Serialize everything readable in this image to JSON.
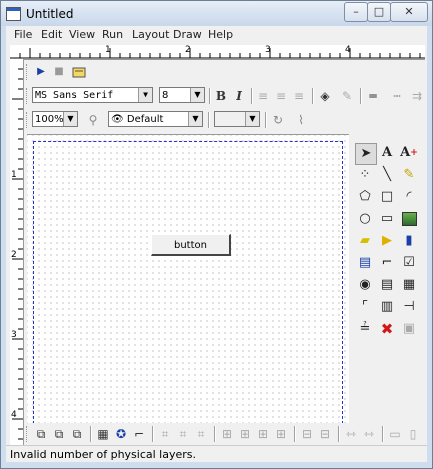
{
  "window": {
    "title": "Untitled"
  },
  "titlebar_buttons": {
    "minimize": "–",
    "maximize": "□",
    "close": "✕"
  },
  "menu": [
    "File",
    "Edit",
    "View",
    "Run",
    "Layout",
    "Draw",
    "Help"
  ],
  "ruler": {
    "horizontal_labels": [
      "1",
      "2",
      "3",
      "4"
    ],
    "vertical_labels": [
      "1",
      "2",
      "3",
      "4"
    ]
  },
  "run_toolbar": {
    "run_icon": "▶",
    "stop_icon": "■",
    "edit_icon": "edit-icon"
  },
  "format_toolbar": {
    "font_name": "MS Sans Serif",
    "font_size": "8",
    "bold": "B",
    "italic": "I"
  },
  "view_toolbar": {
    "zoom": "100%",
    "visual_state": "Default",
    "layer_value": ""
  },
  "canvas": {
    "button_label": "button"
  },
  "status": {
    "message": "Invalid number of physical layers."
  },
  "palette": [
    "pointer-icon",
    "text-icon",
    "text-plus-icon",
    "point-icon",
    "line-icon",
    "pencil-icon",
    "polygon-icon",
    "rectangle-icon",
    "arc-icon",
    "ellipse-icon",
    "frame-icon",
    "image-icon",
    "highlighter-icon",
    "flag-icon",
    "battery-icon",
    "chart-icon",
    "corner-icon",
    "checkbox-icon",
    "radio-icon",
    "list-icon",
    "grid-icon",
    "bracket-icon",
    "report-icon",
    "slider-icon",
    "scale-icon",
    "stop-icon",
    "ole-icon"
  ],
  "colors": {
    "window_frame": "#cfdeef",
    "canvas_margin": "#2233cc",
    "stop_red": "#d01818"
  }
}
